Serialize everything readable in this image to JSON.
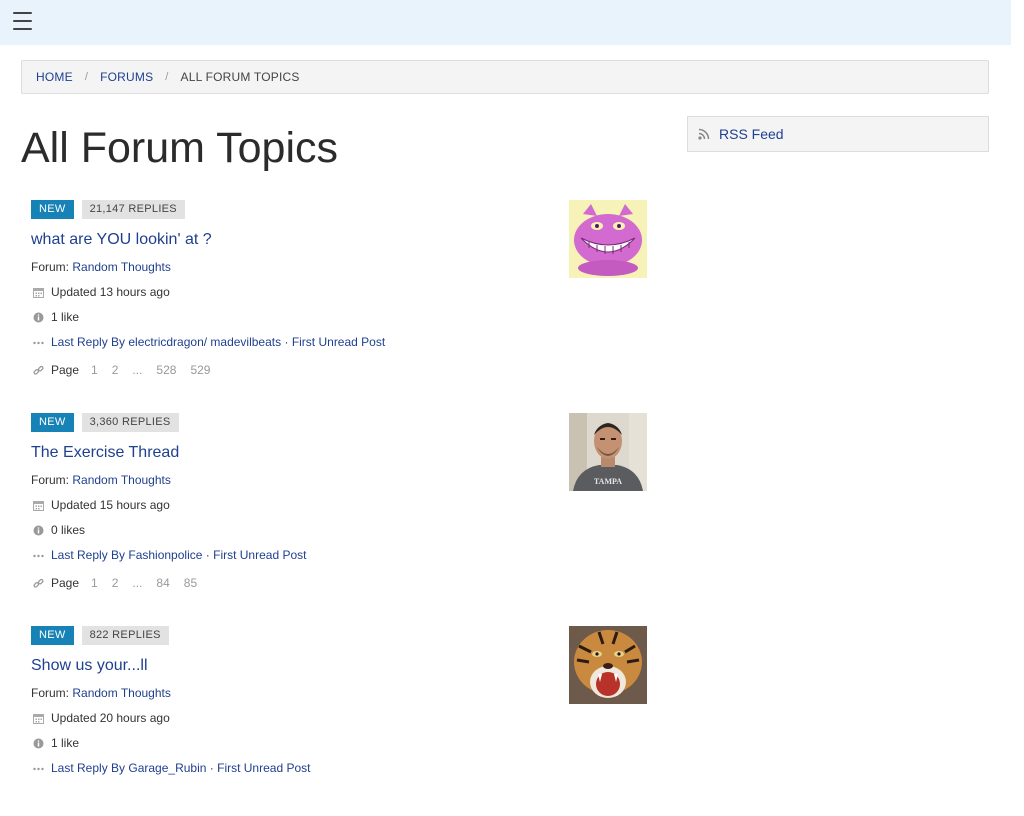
{
  "breadcrumb": {
    "home": "HOME",
    "forums": "FORUMS",
    "current": "ALL FORUM TOPICS",
    "separator": "/"
  },
  "page_title": "All Forum Topics",
  "rss": {
    "label": "RSS Feed"
  },
  "topics": [
    {
      "badge_new": "NEW",
      "replies": "21,147 REPLIES",
      "title": "what are YOU lookin' at ?",
      "forum_prefix": "Forum:",
      "forum_name": "Random Thoughts",
      "updated": "Updated 13 hours ago",
      "likes": "1 like",
      "last_reply": "Last Reply By electricdragon/ madevilbeats",
      "separator": "·",
      "first_unread": "First Unread Post",
      "page_label": "Page",
      "pages": [
        "1",
        "2",
        "...",
        "528",
        "529"
      ],
      "avatar_icon": "cheshire-cat-avatar"
    },
    {
      "badge_new": "NEW",
      "replies": "3,360 REPLIES",
      "title": "The Exercise Thread",
      "forum_prefix": "Forum:",
      "forum_name": "Random Thoughts",
      "updated": "Updated 15 hours ago",
      "likes": "0 likes",
      "last_reply": "Last Reply By Fashionpolice",
      "separator": "·",
      "first_unread": "First Unread Post",
      "page_label": "Page",
      "pages": [
        "1",
        "2",
        "...",
        "84",
        "85"
      ],
      "avatar_icon": "man-tampa-shirt-avatar",
      "avatar_text": "TAMPA"
    },
    {
      "badge_new": "NEW",
      "replies": "822 REPLIES",
      "title": "Show us your...ll",
      "forum_prefix": "Forum:",
      "forum_name": "Random Thoughts",
      "updated": "Updated 20 hours ago",
      "likes": "1 like",
      "last_reply": "Last Reply By Garage_Rubin",
      "separator": "·",
      "first_unread": "First Unread Post",
      "avatar_icon": "tiger-avatar"
    }
  ],
  "colors": {
    "link": "#1f3f8f",
    "badge_new": "#1682b6",
    "topbar": "#e8f3fc"
  }
}
